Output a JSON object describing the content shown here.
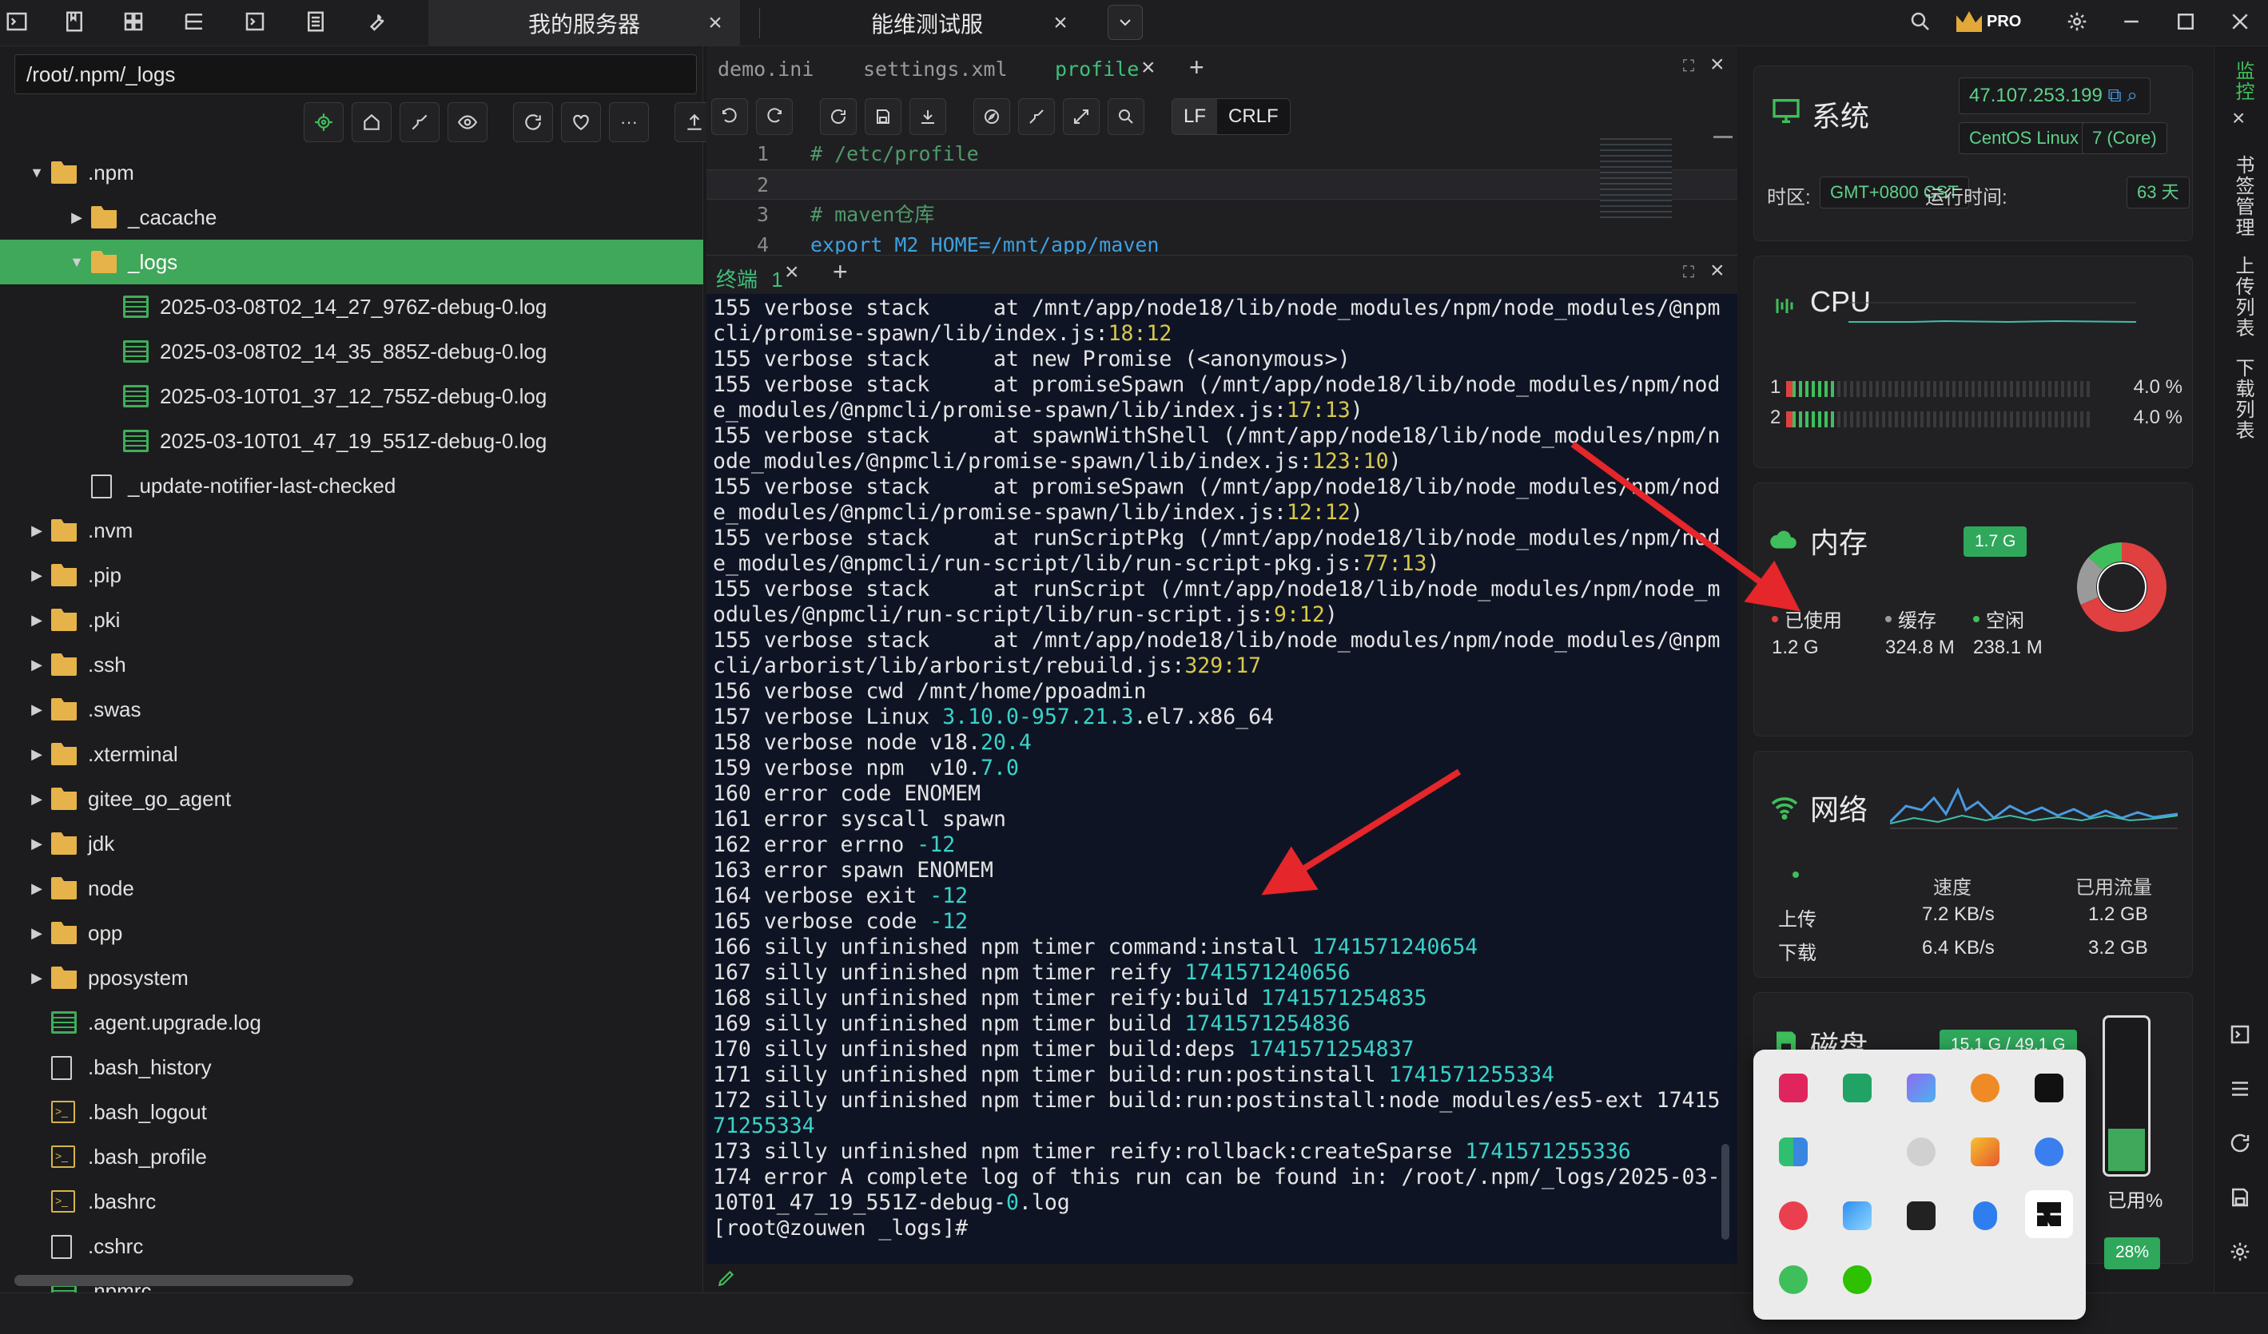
{
  "topbar": {
    "tabs": [
      {
        "label": "我的服务器",
        "active": true
      },
      {
        "label": "能维测试服",
        "active": false
      }
    ],
    "pro_label": "PRO"
  },
  "file_panel": {
    "path": "/root/.npm/_logs",
    "tree": [
      {
        "name": ".npm",
        "type": "folder",
        "level": 1,
        "expanded": true
      },
      {
        "name": "_cacache",
        "type": "folder",
        "level": 2,
        "expanded": false
      },
      {
        "name": "_logs",
        "type": "folder",
        "level": 2,
        "expanded": true,
        "selected": true
      },
      {
        "name": "2025-03-08T02_14_27_976Z-debug-0.log",
        "type": "log",
        "level": 3
      },
      {
        "name": "2025-03-08T02_14_35_885Z-debug-0.log",
        "type": "log",
        "level": 3
      },
      {
        "name": "2025-03-10T01_37_12_755Z-debug-0.log",
        "type": "log",
        "level": 3
      },
      {
        "name": "2025-03-10T01_47_19_551Z-debug-0.log",
        "type": "log",
        "level": 3
      },
      {
        "name": "_update-notifier-last-checked",
        "type": "doc",
        "level": 2
      },
      {
        "name": ".nvm",
        "type": "folder",
        "level": 1
      },
      {
        "name": ".pip",
        "type": "folder",
        "level": 1
      },
      {
        "name": ".pki",
        "type": "folder",
        "level": 1
      },
      {
        "name": ".ssh",
        "type": "folder",
        "level": 1
      },
      {
        "name": ".swas",
        "type": "folder",
        "level": 1
      },
      {
        "name": ".xterminal",
        "type": "folder",
        "level": 1
      },
      {
        "name": "gitee_go_agent",
        "type": "folder",
        "level": 1
      },
      {
        "name": "jdk",
        "type": "folder",
        "level": 1
      },
      {
        "name": "node",
        "type": "folder",
        "level": 1
      },
      {
        "name": "opp",
        "type": "folder",
        "level": 1
      },
      {
        "name": "pposystem",
        "type": "folder",
        "level": 1
      },
      {
        "name": ".agent.upgrade.log",
        "type": "log",
        "level": 1
      },
      {
        "name": ".bash_history",
        "type": "doc",
        "level": 1
      },
      {
        "name": ".bash_logout",
        "type": "sh",
        "level": 1
      },
      {
        "name": ".bash_profile",
        "type": "sh",
        "level": 1
      },
      {
        "name": ".bashrc",
        "type": "sh",
        "level": 1
      },
      {
        "name": ".cshrc",
        "type": "doc",
        "level": 1
      },
      {
        "name": ".npmrc",
        "type": "log",
        "level": 1
      }
    ]
  },
  "editor": {
    "tabs": [
      "demo.ini",
      "settings.xml",
      "profile"
    ],
    "active_tab": "profile",
    "line_endings": [
      "LF",
      "CRLF"
    ],
    "lines": [
      {
        "n": "1",
        "text": "# /etc/profile",
        "kind": "comment"
      },
      {
        "n": "2",
        "text": "",
        "kind": "plain"
      },
      {
        "n": "3",
        "text": "# maven仓库",
        "kind": "comment"
      },
      {
        "n": "4",
        "text": "export M2_HOME=/mnt/app/maven",
        "kind": "code"
      }
    ]
  },
  "terminal": {
    "tab_label": "终端",
    "tab_count": "1",
    "lines": [
      [
        [
          "155 verbose stack     at /mnt/app/node18/lib/node_modules/npm/node_modules/@npm",
          ""
        ]
      ],
      [
        [
          "cli/promise-spawn/lib/index.js:",
          ""
        ],
        [
          "18:12",
          "y"
        ]
      ],
      [
        [
          "155 verbose stack     at new Promise (<anonymous>)",
          ""
        ]
      ],
      [
        [
          "155 verbose stack     at promiseSpawn (/mnt/app/node18/lib/node_modules/npm/nod",
          ""
        ]
      ],
      [
        [
          "e_modules/@npmcli/promise-spawn/lib/index.js:",
          ""
        ],
        [
          "17:13",
          "y"
        ],
        [
          ")",
          ""
        ]
      ],
      [
        [
          "155 verbose stack     at spawnWithShell (/mnt/app/node18/lib/node_modules/npm/n",
          ""
        ]
      ],
      [
        [
          "ode_modules/@npmcli/promise-spawn/lib/index.js:",
          ""
        ],
        [
          "123:10",
          "y"
        ],
        [
          ")",
          ""
        ]
      ],
      [
        [
          "155 verbose stack     at promiseSpawn (/mnt/app/node18/lib/node_modules/npm/nod",
          ""
        ]
      ],
      [
        [
          "e_modules/@npmcli/promise-spawn/lib/index.js:",
          ""
        ],
        [
          "12:12",
          "y"
        ],
        [
          ")",
          ""
        ]
      ],
      [
        [
          "155 verbose stack     at runScriptPkg (/mnt/app/node18/lib/node_modules/npm/nod",
          ""
        ]
      ],
      [
        [
          "e_modules/@npmcli/run-script/lib/run-script-pkg.js:",
          ""
        ],
        [
          "77:13",
          "y"
        ],
        [
          ")",
          ""
        ]
      ],
      [
        [
          "155 verbose stack     at runScript (/mnt/app/node18/lib/node_modules/npm/node_m",
          ""
        ]
      ],
      [
        [
          "odules/@npmcli/run-script/lib/run-script.js:",
          ""
        ],
        [
          "9:12",
          "y"
        ],
        [
          ")",
          ""
        ]
      ],
      [
        [
          "155 verbose stack     at /mnt/app/node18/lib/node_modules/npm/node_modules/@npm",
          ""
        ]
      ],
      [
        [
          "cli/arborist/lib/arborist/rebuild.js:",
          ""
        ],
        [
          "329:17",
          "y"
        ]
      ],
      [
        [
          "156 verbose cwd /mnt/home/ppoadmin",
          ""
        ]
      ],
      [
        [
          "157 verbose Linux ",
          ""
        ],
        [
          "3.10.0-957.21.3",
          "c"
        ],
        [
          ".el7.x86_64",
          ""
        ]
      ],
      [
        [
          "158 verbose node v18.",
          ""
        ],
        [
          "20.4",
          "c"
        ]
      ],
      [
        [
          "159 verbose npm  v10.",
          ""
        ],
        [
          "7.0",
          "c"
        ]
      ],
      [
        [
          "160 error code ENOMEM",
          ""
        ]
      ],
      [
        [
          "161 error syscall spawn",
          ""
        ]
      ],
      [
        [
          "162 error errno ",
          ""
        ],
        [
          "-12",
          "c"
        ]
      ],
      [
        [
          "163 error spawn ENOMEM",
          ""
        ]
      ],
      [
        [
          "164 verbose exit ",
          ""
        ],
        [
          "-12",
          "c"
        ]
      ],
      [
        [
          "165 verbose code ",
          ""
        ],
        [
          "-12",
          "c"
        ]
      ],
      [
        [
          "166 silly unfinished npm timer command:install ",
          ""
        ],
        [
          "1741571240654",
          "c"
        ]
      ],
      [
        [
          "167 silly unfinished npm timer reify ",
          ""
        ],
        [
          "1741571240656",
          "c"
        ]
      ],
      [
        [
          "168 silly unfinished npm timer reify:build ",
          ""
        ],
        [
          "1741571254835",
          "c"
        ]
      ],
      [
        [
          "169 silly unfinished npm timer build ",
          ""
        ],
        [
          "1741571254836",
          "c"
        ]
      ],
      [
        [
          "170 silly unfinished npm timer build:deps ",
          ""
        ],
        [
          "1741571254837",
          "c"
        ]
      ],
      [
        [
          "171 silly unfinished npm timer build:run:postinstall ",
          ""
        ],
        [
          "1741571255334",
          "c"
        ]
      ],
      [
        [
          "172 silly unfinished npm timer build:run:postinstall:node_modules/es5-ext 17415",
          ""
        ]
      ],
      [
        [
          "71255334",
          "c"
        ]
      ],
      [
        [
          "173 silly unfinished npm timer reify:rollback:createSparse ",
          ""
        ],
        [
          "1741571255336",
          "c"
        ]
      ],
      [
        [
          "174 error A complete log of this run can be found in: /root/.npm/_logs/2025-03-",
          ""
        ]
      ],
      [
        [
          "10T01_47_19_551Z-debug-",
          ""
        ],
        [
          "0",
          "c"
        ],
        [
          ".log",
          ""
        ]
      ],
      [
        [
          "[root@zouwen _logs]#",
          ""
        ]
      ]
    ]
  },
  "monitor": {
    "system": {
      "title": "系统",
      "ip": "47.107.253.199",
      "os": "CentOS Linux",
      "cores": "7 (Core)",
      "tz_label": "时区:",
      "tz_value": "GMT+0800  CST",
      "uptime_label": "运行时间:",
      "uptime_value": "63 天"
    },
    "cpu": {
      "title": "CPU",
      "cores": [
        {
          "id": "1",
          "pct": "4.0 %",
          "value": 4.0
        },
        {
          "id": "2",
          "pct": "4.0 %",
          "value": 4.0
        }
      ]
    },
    "memory": {
      "title": "内存",
      "total": "1.7 G",
      "legend": [
        {
          "label": "已使用",
          "value": "1.2 G",
          "color": "#e04040"
        },
        {
          "label": "缓存",
          "value": "324.8 M",
          "color": "#9a9a9a"
        },
        {
          "label": "空闲",
          "value": "238.1 M",
          "color": "#3fbf5b"
        }
      ],
      "donut": [
        1.2,
        0.3172,
        0.2325
      ]
    },
    "network": {
      "title": "网络",
      "col_speed": "速度",
      "col_used": "已用流量",
      "rows": [
        {
          "label": "上传",
          "speed": "7.2 KB/s",
          "used": "1.2 GB"
        },
        {
          "label": "下载",
          "speed": "6.4 KB/s",
          "used": "3.2 GB"
        }
      ]
    },
    "disk": {
      "title": "磁盘",
      "usage": "15.1 G / 49.1 G",
      "used_label": "已用%",
      "pct_label": "28%",
      "fraction": 0.28
    }
  },
  "sidebar_strip": {
    "items": [
      "监控",
      "书签管理",
      "上传列表",
      "下载列表"
    ],
    "active": "监控"
  },
  "colors": {
    "accent": "#3fa85a",
    "terminal_bg": "#0f1425",
    "number_cyan": "#39d3c8",
    "number_yellow": "#d8c84a"
  }
}
